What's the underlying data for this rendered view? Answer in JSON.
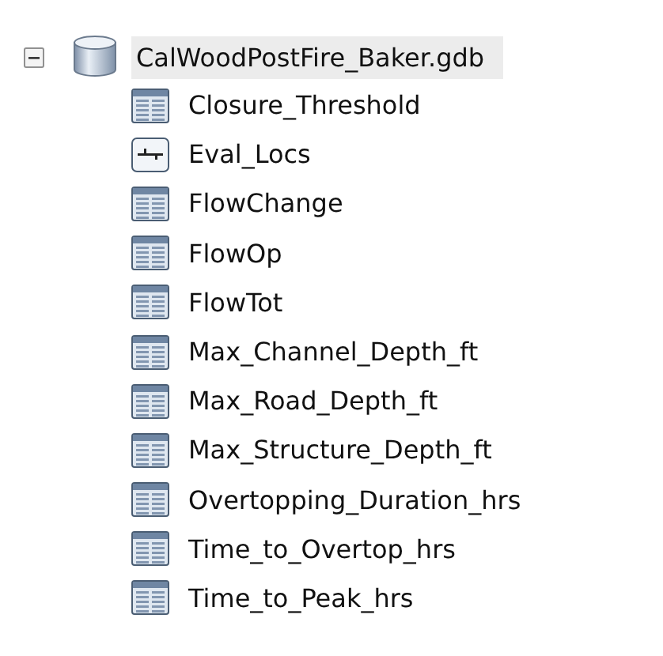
{
  "tree": {
    "label": "CalWoodPostFire_Baker.gdb",
    "expanded": true,
    "selected": true,
    "children": [
      {
        "label": "Closure_Threshold",
        "kind": "table"
      },
      {
        "label": "Eval_Locs",
        "kind": "point"
      },
      {
        "label": "FlowChange",
        "kind": "table"
      },
      {
        "label": "FlowOp",
        "kind": "table"
      },
      {
        "label": "FlowTot",
        "kind": "table"
      },
      {
        "label": "Max_Channel_Depth_ft",
        "kind": "table"
      },
      {
        "label": "Max_Road_Depth_ft",
        "kind": "table"
      },
      {
        "label": "Max_Structure_Depth_ft",
        "kind": "table"
      },
      {
        "label": "Overtopping_Duration_hrs",
        "kind": "table"
      },
      {
        "label": "Time_to_Overtop_hrs",
        "kind": "table"
      },
      {
        "label": "Time_to_Peak_hrs",
        "kind": "table"
      }
    ]
  }
}
